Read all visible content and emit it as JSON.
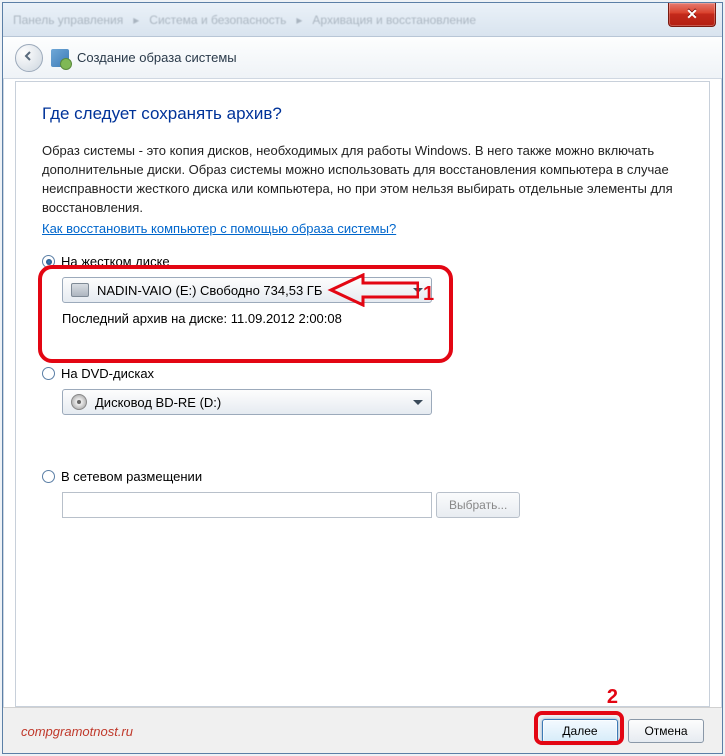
{
  "breadcrumb": {
    "a": "Панель управления",
    "b": "Система и безопасность",
    "c": "Архивация и восстановление"
  },
  "header": {
    "title": "Создание образа системы"
  },
  "main": {
    "heading": "Где следует сохранять архив?",
    "description": "Образ системы - это копия дисков, необходимых для работы Windows. В него также можно включать дополнительные диски. Образ системы можно использовать для восстановления компьютера в случае неисправности жесткого диска или компьютера, но при этом нельзя выбирать отдельные элементы для восстановления.",
    "help_link": "Как восстановить компьютер с помощью образа системы?"
  },
  "options": {
    "hdd": {
      "label": "На жестком диске",
      "selected_value": "NADIN-VAIO (E:)  Свободно 734,53 ГБ",
      "last_backup_label": "Последний архив на диске:",
      "last_backup_time": "11.09.2012 2:00:08"
    },
    "dvd": {
      "label": "На DVD-дисках",
      "selected_value": "Дисковод BD-RE (D:)"
    },
    "network": {
      "label": "В сетевом размещении",
      "browse_label": "Выбрать..."
    }
  },
  "markers": {
    "one": "1",
    "two": "2"
  },
  "footer": {
    "next": "Далее",
    "cancel": "Отмена"
  },
  "watermark": "compgramotnost.ru"
}
